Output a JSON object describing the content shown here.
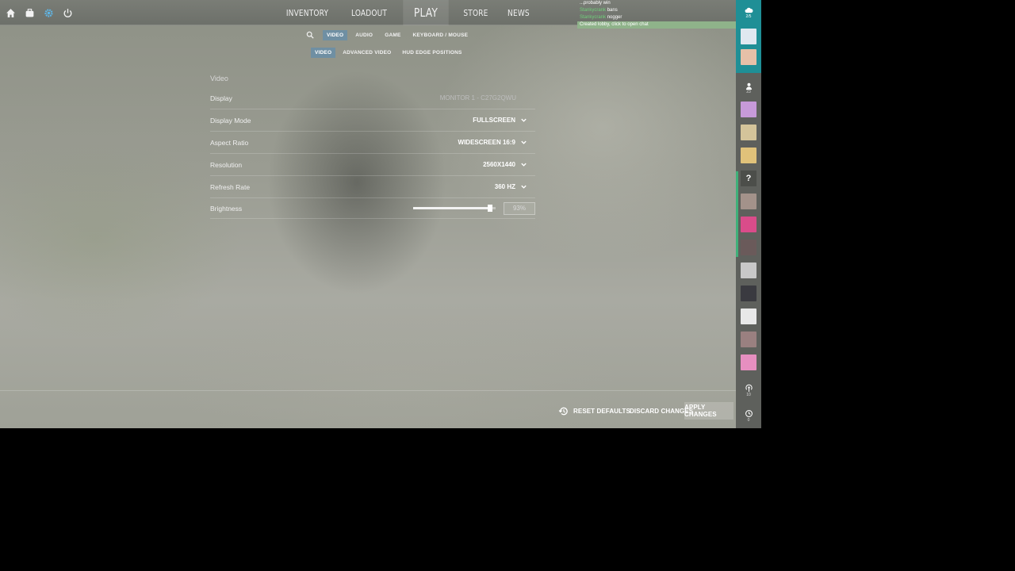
{
  "topbar": {
    "icons": [
      "home-icon",
      "inventory-case-icon",
      "gear-icon",
      "power-icon"
    ],
    "nav": {
      "inventory": "INVENTORY",
      "loadout": "LOADOUT",
      "play": "PLAY",
      "store": "STORE",
      "news": "NEWS"
    }
  },
  "chat": {
    "lines": [
      {
        "who": "",
        "text": "...probably win"
      },
      {
        "who": "Stankycrank",
        "text": "bans"
      },
      {
        "who": "Stankycrank",
        "text": "nogger"
      },
      {
        "who": "",
        "text": "Created lobby, click to open chat"
      }
    ]
  },
  "tabs": {
    "video": "VIDEO",
    "audio": "AUDIO",
    "game": "GAME",
    "keyboard_mouse": "KEYBOARD / MOUSE"
  },
  "subtabs": {
    "video": "VIDEO",
    "advanced_video": "ADVANCED VIDEO",
    "hud_edge": "HUD EDGE POSITIONS"
  },
  "settings": {
    "section_title": "Video",
    "rows": [
      {
        "label": "Display",
        "value": "MONITOR 1 - C27G2QWU"
      },
      {
        "label": "Display Mode",
        "value": "FULLSCREEN"
      },
      {
        "label": "Aspect Ratio",
        "value": "WIDESCREEN 16:9"
      },
      {
        "label": "Resolution",
        "value": "2560X1440"
      },
      {
        "label": "Refresh Rate",
        "value": "360 HZ"
      }
    ],
    "brightness": {
      "label": "Brightness",
      "percent": 93,
      "display": "93%"
    }
  },
  "bottombar": {
    "reset": "RESET DEFAULTS",
    "discard": "DISCARD CHANGES",
    "apply": "APPLY CHANGES"
  },
  "sidebar": {
    "party_count": "2/5",
    "friends_count": "23",
    "bottom1_count": "10",
    "bottom2_count": "0",
    "avatar_colors": [
      "#c79ad9",
      "#d4c49a",
      "#e0c27a",
      "#a3928a",
      "#d94c8a",
      "#6a5a5a",
      "#c8c8c8",
      "#3a3a40",
      "#e8e8e8",
      "#9a8080",
      "#e68fc0"
    ],
    "party_avatar_colors": [
      "#e0e8f0",
      "#e6c0a8"
    ],
    "accent": "#1f8f96"
  }
}
